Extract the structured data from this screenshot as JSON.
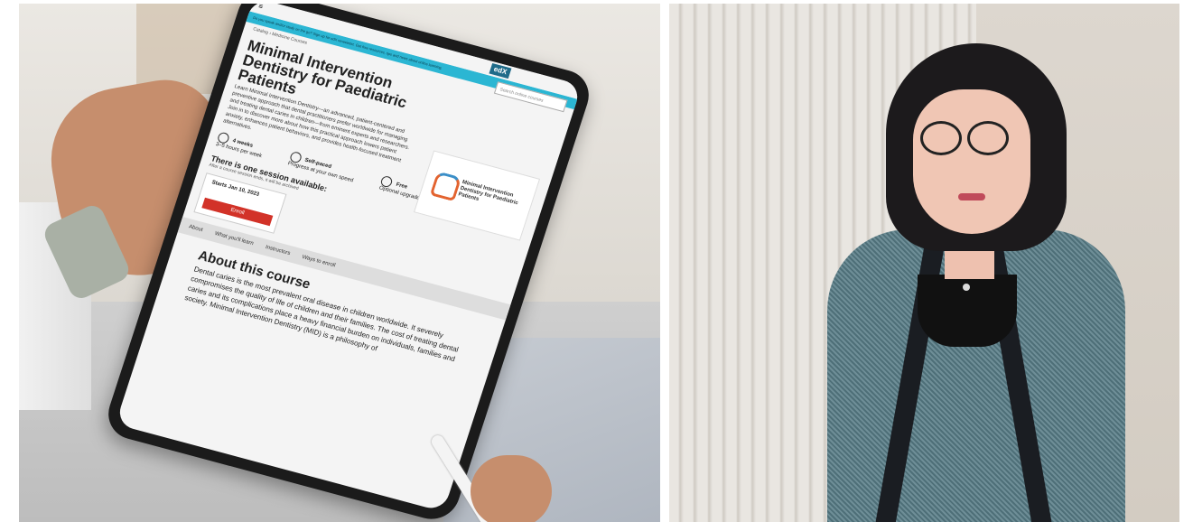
{
  "tablet_page": {
    "banner_text": "Do you speak and/or study on the go? Sign up for edX newsletter. Get free resources, tips and news about online learning.",
    "logo_text": "edX",
    "search_placeholder": "Search online courses",
    "breadcrumb": "Catalog  ›  Medicine Courses",
    "course_title": "Minimal Intervention Dentistry for Paediatric Patients",
    "course_description": "Learn Minimal Intervention Dentistry—an advanced, patient-centered and preventive approach that dental practitioners prefer worldwide for managing and treating dental caries in children—from eminent experts and researchers. Join in to discover more about how this practical approach lowers patient anxiety, enhances patient behaviors, and provides health-focused treatment alternatives.",
    "card_title": "Minimal Intervention Dentistry for Paediatric Patients",
    "duration": "4 weeks",
    "duration_sub": "3–5 hours per week",
    "pace": "Self-paced",
    "pace_sub": "Progress at your own speed",
    "price": "Free",
    "price_sub": "Optional upgrade available",
    "session_heading": "There is one session available:",
    "session_sub": "After a course session ends, it will be archived",
    "starts": "Starts Jan 10, 2023",
    "enroll_label": "Enroll",
    "tabs": [
      "About",
      "What you'll learn",
      "Instructors",
      "Ways to enroll"
    ],
    "about_heading": "About this course",
    "about_text": "Dental caries is the most prevalent oral disease in children worldwide. It severely compromises the quality of life of children and their families. The cost of treating dental caries and its complications place a heavy financial burden on individuals, families and society. Minimal Intervention Dentistry (MID) is a philosophy of"
  }
}
